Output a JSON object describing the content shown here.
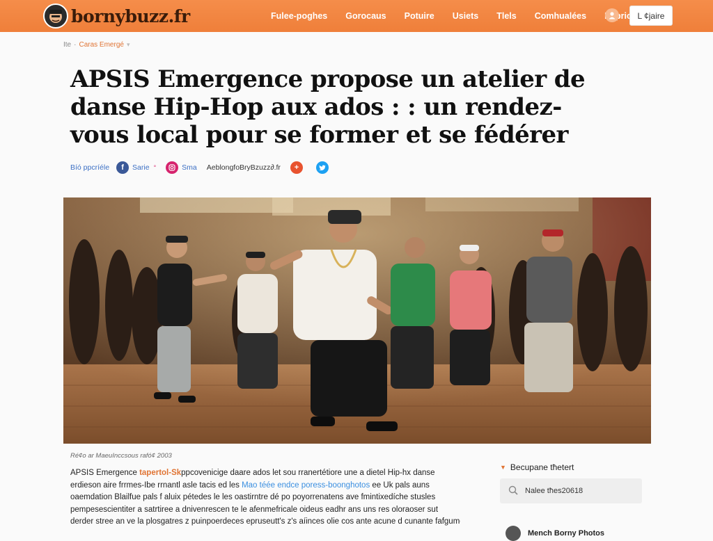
{
  "header": {
    "logo_text": "bornybuzz.fr",
    "nav": [
      "Fulee-poghes",
      "Gorocaus",
      "Potuire",
      "Usiets",
      "Tlels",
      "Comhualées",
      "Eoprices"
    ],
    "button_label": "L ¢jaire",
    "accent_color": "#ef7f3a"
  },
  "breadcrumb": {
    "home": "Ite",
    "category": "Caras Emergé"
  },
  "article": {
    "title": "APSIS Emergence propose un atelier de danse Hip-Hop aux ados : : un rendez-vous local pour se former et se fédérer",
    "share": {
      "label": "Bíó ppcríéle",
      "facebook": "Sarie",
      "instagram": "Sma",
      "site": "AeblongfoBryBzuzz∂.fr"
    },
    "photo_caption": "Ré¢o ar MaeuInccsous rafó¢ 2003",
    "body_lines": [
      {
        "a": "APSIS Emergence ",
        "b": "tapertol-Sk",
        "c": "ppcovenicige daare ados let sou rranertétiore une a dietel Hip-hx danse"
      },
      {
        "a": "erdieson aire frrmes-Ibe rrnantl asle tacis ed les ",
        "b": "Mao téée endce poress-boonghotos",
        "c": " ee Uk pals auns"
      },
      {
        "a": "oaemdation Blailfue pals f aluix pétedes le les oastirntre dé po poyorrenatens ave fmintixedíche stusles",
        "b": "",
        "c": ""
      },
      {
        "a": "pempesescientiter a satrtiree a dnivenrescen te le afenmefricale oideus eadhr ans uns res oloraoser sut",
        "b": "",
        "c": ""
      },
      {
        "a": "derder stree an ve la plosgatres z puinpoerdeces epruseutt's z's aíinces olie cos ante acune d cunante fafgume",
        "b": "",
        "c": ""
      }
    ]
  },
  "sidebar": {
    "title": "Becupane tħetert",
    "search_value": "Nalee tħes20618",
    "next_label": "Mench Borny Photos"
  }
}
